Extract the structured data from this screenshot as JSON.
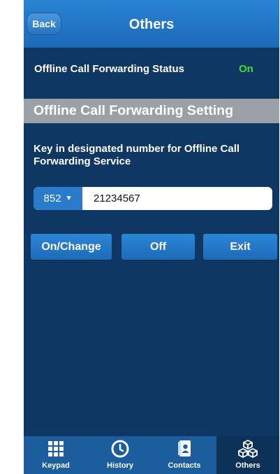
{
  "header": {
    "back_label": "Back",
    "title": "Others"
  },
  "status": {
    "label": "Offline Call Forwarding Status",
    "value": "On",
    "value_color": "#3ddc34"
  },
  "section": {
    "title": "Offline Call Forwarding Setting"
  },
  "instruction": "Key in designated number for Offline Call Forwarding Service",
  "phone_input": {
    "country_code": "852",
    "number": "21234567"
  },
  "actions": {
    "on_change": "On/Change",
    "off": "Off",
    "exit": "Exit"
  },
  "tabs": [
    {
      "label": "Keypad",
      "icon": "keypad-icon"
    },
    {
      "label": "History",
      "icon": "clock-icon"
    },
    {
      "label": "Contacts",
      "icon": "contacts-book-icon"
    },
    {
      "label": "Others",
      "icon": "cubes-icon",
      "active": true
    }
  ],
  "colors": {
    "background": "#0e3763",
    "header": "#2a83d4",
    "section_band": "#9ba0a6",
    "button": "#2c86d6",
    "tabbar": "#1c5d9d",
    "tab_active": "#0d3259"
  }
}
